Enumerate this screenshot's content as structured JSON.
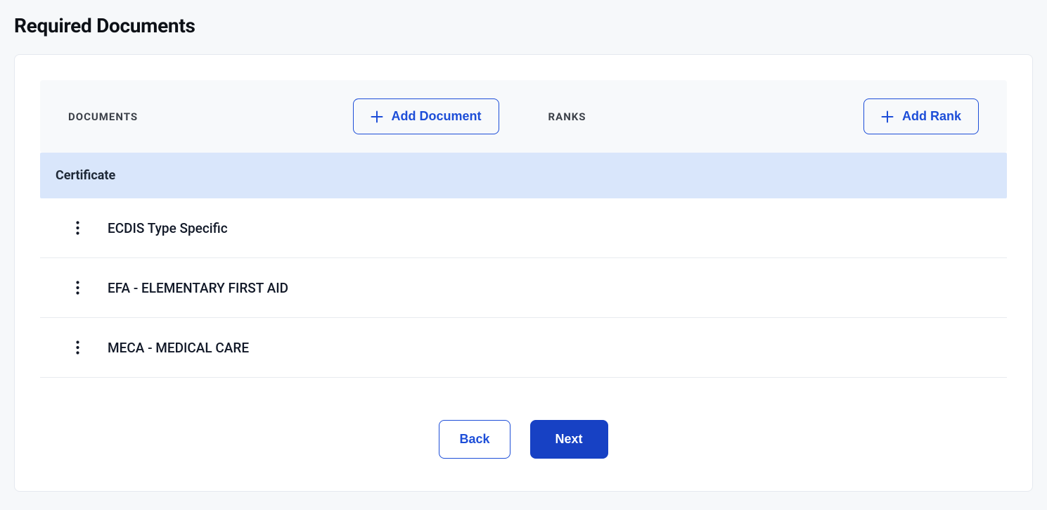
{
  "page": {
    "title": "Required Documents"
  },
  "toolbar": {
    "documents_label": "DOCUMENTS",
    "add_document_label": "Add Document",
    "ranks_label": "RANKS",
    "add_rank_label": "Add Rank"
  },
  "category": {
    "label": "Certificate"
  },
  "items": [
    {
      "name": "ECDIS Type Specific"
    },
    {
      "name": "EFA - ELEMENTARY FIRST AID"
    },
    {
      "name": "MECA - MEDICAL CARE"
    }
  ],
  "footer": {
    "back_label": "Back",
    "next_label": "Next"
  }
}
